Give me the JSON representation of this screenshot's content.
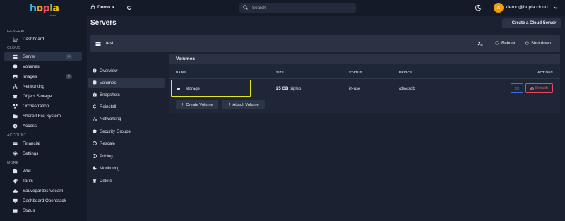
{
  "app": {
    "logo_text": "hopla",
    "logo_sub": "cloud"
  },
  "topbar": {
    "project": "Demo",
    "search_placeholder": "Search",
    "user_initial": "A",
    "user_email": "demo@hopla.cloud"
  },
  "sidebar": {
    "sections": [
      {
        "label": "GENERAL",
        "items": [
          {
            "label": "Dashboard",
            "icon": "chart-icon"
          }
        ]
      },
      {
        "label": "CLOUD",
        "items": [
          {
            "label": "Server",
            "icon": "server-icon",
            "badge": "4",
            "active": true
          },
          {
            "label": "Volumes",
            "icon": "database-icon"
          },
          {
            "label": "Images",
            "icon": "images-icon",
            "badge": "2"
          },
          {
            "label": "Networking",
            "icon": "network-icon"
          },
          {
            "label": "Object Storage",
            "icon": "object-storage-icon"
          },
          {
            "label": "Orchestration",
            "icon": "orchestration-icon"
          },
          {
            "label": "Shared File System",
            "icon": "folder-icon"
          },
          {
            "label": "Access",
            "icon": "access-icon"
          }
        ]
      },
      {
        "label": "ACCOUNT",
        "items": [
          {
            "label": "Financial",
            "icon": "financial-icon"
          },
          {
            "label": "Settings",
            "icon": "gear-icon"
          }
        ]
      },
      {
        "label": "MORE",
        "items": [
          {
            "label": "Wiki",
            "icon": "book-icon"
          },
          {
            "label": "Tarifs",
            "icon": "tag-icon"
          },
          {
            "label": "Sauvegardes Veeam",
            "icon": "backup-icon"
          },
          {
            "label": "Dashboard Openstack",
            "icon": "monitor-icon"
          },
          {
            "label": "Status",
            "icon": "status-icon"
          }
        ]
      }
    ]
  },
  "header": {
    "title": "Servers",
    "create_label": "Create a Cloud Server"
  },
  "server": {
    "name": "test",
    "reboot_label": "Reboot",
    "shutdown_label": "Shut down"
  },
  "tabs": [
    {
      "label": "Overview",
      "icon": "info-icon"
    },
    {
      "label": "Volumes",
      "icon": "database-icon",
      "active": true
    },
    {
      "label": "Snapshots",
      "icon": "camera-icon"
    },
    {
      "label": "Reinstall",
      "icon": "reinstall-icon"
    },
    {
      "label": "Networking",
      "icon": "network-icon"
    },
    {
      "label": "Security Groups",
      "icon": "shield-icon"
    },
    {
      "label": "Rescale",
      "icon": "rescale-icon"
    },
    {
      "label": "Pricing",
      "icon": "pricing-icon"
    },
    {
      "label": "Monitoring",
      "icon": "monitoring-icon"
    },
    {
      "label": "Delete",
      "icon": "trash-icon"
    }
  ],
  "volumes": {
    "title": "Volumes",
    "columns": {
      "name": "NAME",
      "size": "SIZE",
      "status": "STATUS",
      "device": "DEVICE",
      "actions": "ACTIONS"
    },
    "rows": [
      {
        "name": "storage",
        "size": "25 GB",
        "type": "tripleo",
        "status": "in-use",
        "device": "/dev/sdb",
        "detach_label": "Detach"
      }
    ],
    "create_label": "Create Volume",
    "attach_label": "Attach Volume"
  },
  "colors": {
    "accent": "#3e6fd6",
    "danger": "#ef5b6b",
    "highlight": "#e5e61a",
    "avatar": "#f39c12"
  }
}
